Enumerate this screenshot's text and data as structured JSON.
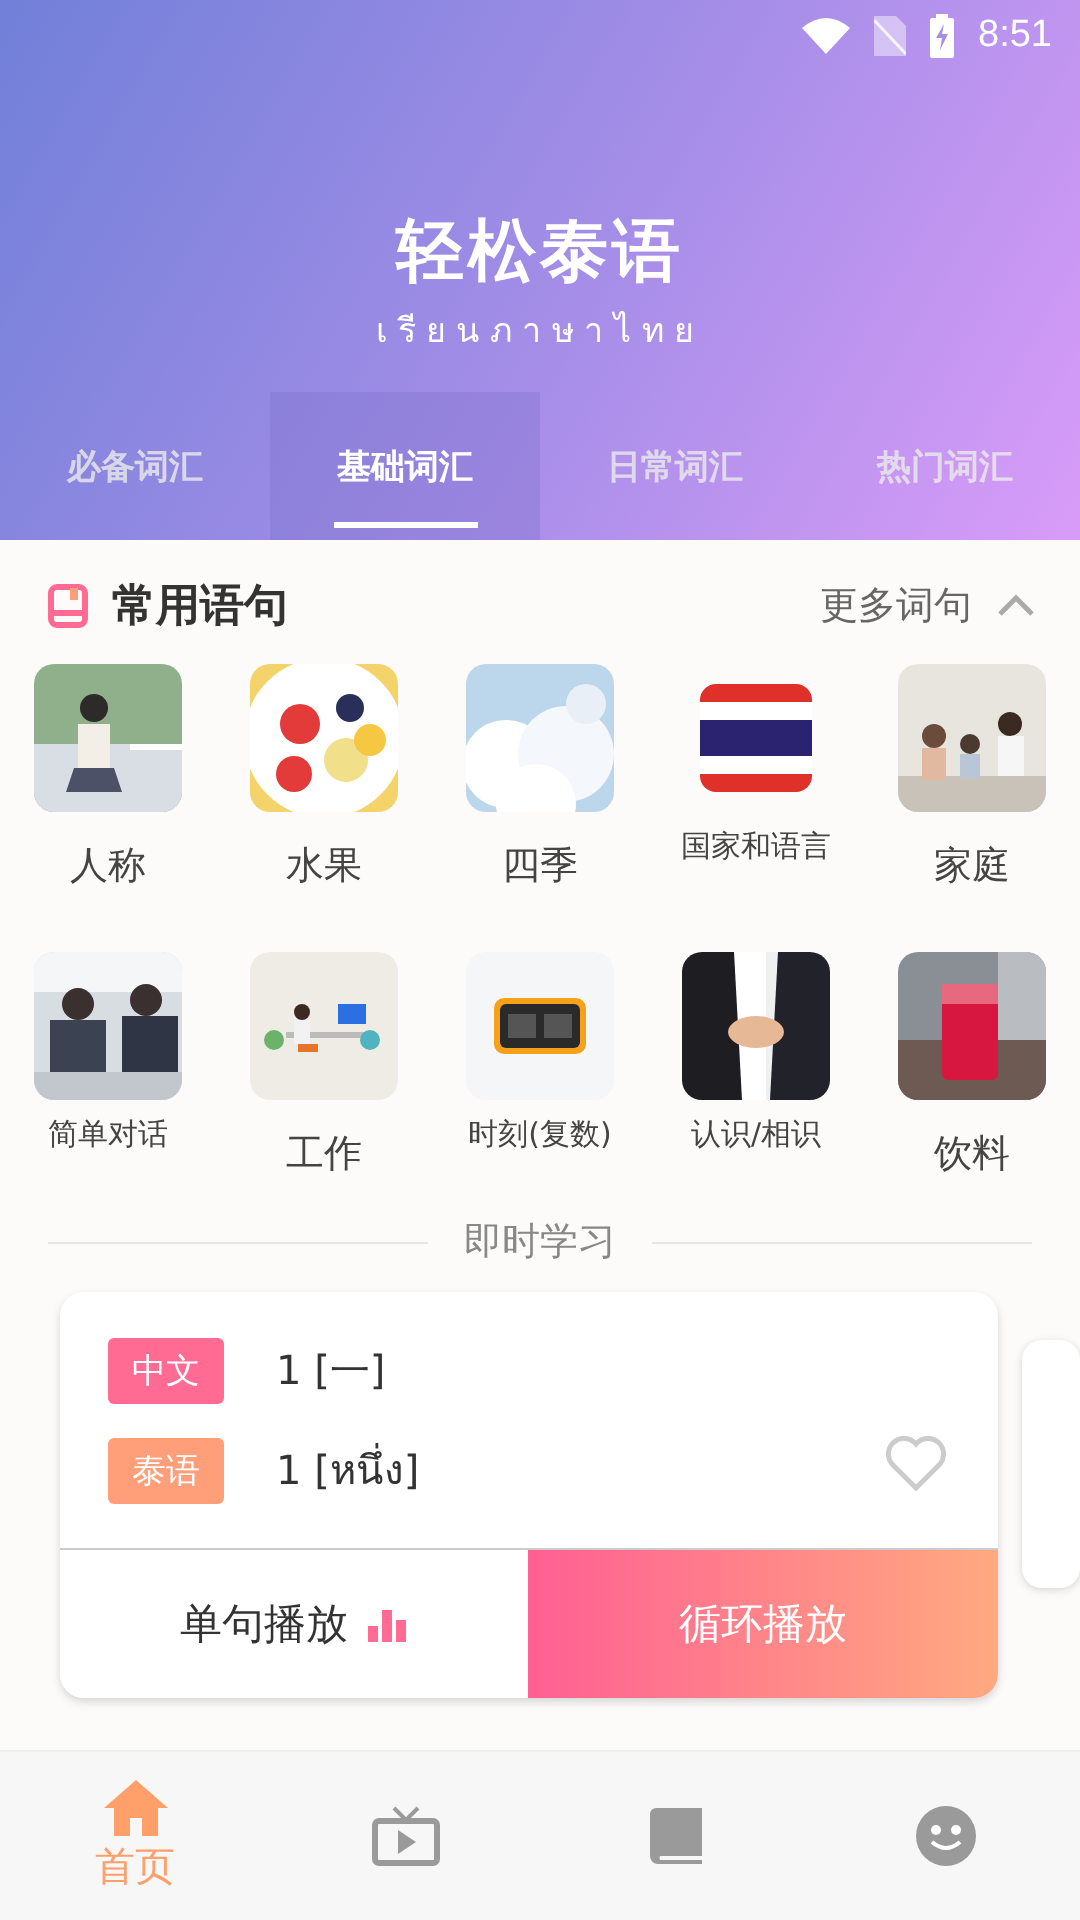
{
  "status_bar": {
    "time": "8:51"
  },
  "header": {
    "title": "轻松泰语",
    "subtitle": "เรียนภาษาไทย"
  },
  "tabs": [
    {
      "label": "必备词汇",
      "selected": false
    },
    {
      "label": "基础词汇",
      "selected": true
    },
    {
      "label": "日常词汇",
      "selected": false
    },
    {
      "label": "热门词汇",
      "selected": false
    }
  ],
  "section": {
    "title": "常用语句",
    "more": "更多词句",
    "expanded": true
  },
  "categories": [
    {
      "label": "人称",
      "kind": "picture"
    },
    {
      "label": "水果",
      "kind": "picture"
    },
    {
      "label": "四季",
      "kind": "picture"
    },
    {
      "label": "国家和语言",
      "kind": "flag"
    },
    {
      "label": "家庭",
      "kind": "picture"
    },
    {
      "label": "简单对话",
      "kind": "picture"
    },
    {
      "label": "工作",
      "kind": "picture"
    },
    {
      "label": "时刻(复数)",
      "kind": "clock"
    },
    {
      "label": "认识/相识",
      "kind": "picture"
    },
    {
      "label": "饮料",
      "kind": "picture"
    }
  ],
  "study": {
    "heading": "即时学习",
    "rows": [
      {
        "tag": "中文",
        "text": "1 [一]",
        "color": "#ff6b93"
      },
      {
        "tag": "泰语",
        "text": "1 [หนึ่ง]",
        "color": "#ff9f7a"
      }
    ],
    "favorite": false,
    "buttons": [
      {
        "label": "单句播放",
        "selected": false
      },
      {
        "label": "循环播放",
        "selected": true
      }
    ]
  },
  "nav": [
    {
      "label": "首页",
      "kind": "home",
      "selected": true
    },
    {
      "kind": "tv",
      "selected": false
    },
    {
      "kind": "book",
      "selected": false
    },
    {
      "kind": "face",
      "selected": false
    }
  ]
}
